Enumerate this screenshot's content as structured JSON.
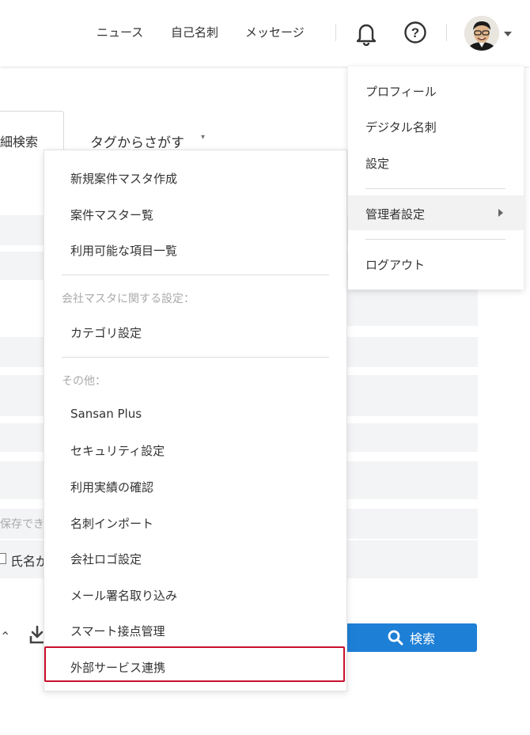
{
  "header": {
    "nav": [
      "ニュース",
      "自己名刺",
      "メッセージ"
    ],
    "icons": {
      "notification": "bell-icon",
      "help": "question-circle-icon",
      "profile": "avatar"
    }
  },
  "background": {
    "tab_label": "細検索",
    "tag_search_label": "タグからさがす",
    "tag_search_caret": "▾",
    "hint_text": "保存でき",
    "checkbox_label": "氏名が",
    "search_button_label": "検索"
  },
  "admin_menu": {
    "items_top": [
      "新規案件マスタ作成",
      "案件マスター覧",
      "利用可能な項目一覧"
    ],
    "section_company": "会社マスタに関する設定：",
    "items_company": [
      "カテゴリ設定"
    ],
    "section_other": "その他：",
    "items_other": [
      "Sansan Plus",
      "セキュリティ設定",
      "利用実績の確認",
      "名刺インポート",
      "会社ロゴ設定",
      "メール署名取り込み",
      "スマート接点管理",
      "外部サービス連携"
    ],
    "highlighted_item": "外部サービス連携"
  },
  "user_menu": {
    "items": [
      "プロフィール",
      "デジタル名刺",
      "設定"
    ],
    "admin": "管理者設定",
    "logout": "ログアウト"
  },
  "colors": {
    "accent": "#1e7fd6",
    "highlight_border": "#c8102e",
    "stripe": "#f3f4f6"
  }
}
